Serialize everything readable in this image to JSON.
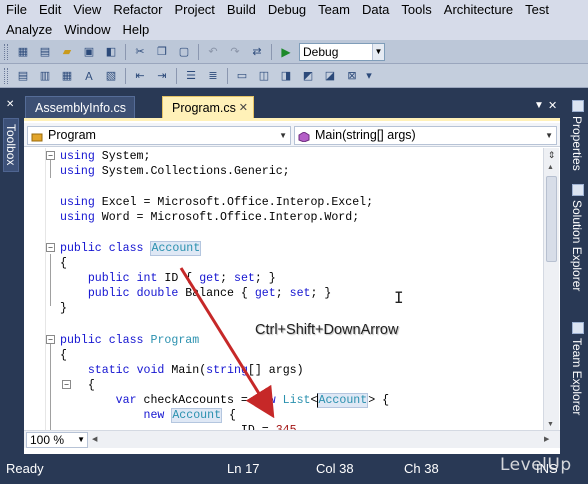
{
  "menubar": {
    "row1": [
      "File",
      "Edit",
      "View",
      "Refactor",
      "Project",
      "Build",
      "Debug",
      "Team",
      "Data",
      "Tools",
      "Architecture",
      "Test"
    ],
    "row2": [
      "Analyze",
      "Window",
      "Help"
    ]
  },
  "toolbar": {
    "config_value": "Debug"
  },
  "tool_windows": {
    "left": "Toolbox",
    "right": [
      "Properties",
      "Solution Explorer",
      "Team Explorer"
    ]
  },
  "tabs": [
    {
      "label": "AssemblyInfo.cs"
    },
    {
      "label": "Program.cs"
    }
  ],
  "navbar": {
    "type_combo": "Program",
    "member_combo": "Main(string[] args)"
  },
  "editor": {
    "zoom": "100 %"
  },
  "annotation": {
    "text": "Ctrl+Shift+DownArrow"
  },
  "status": {
    "ready": "Ready",
    "ln": "Ln 17",
    "col": "Col 38",
    "ch": "Ch 38",
    "ins": "INS"
  },
  "watermark": "LevelUp"
}
